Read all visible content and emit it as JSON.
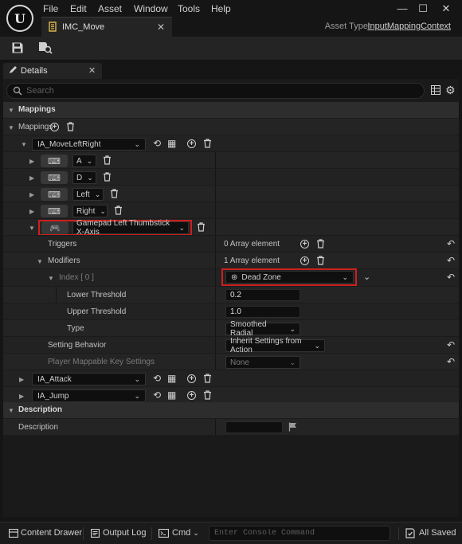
{
  "menu": [
    "File",
    "Edit",
    "Asset",
    "Window",
    "Tools",
    "Help"
  ],
  "asset_tab": {
    "title": "IMC_Move",
    "asset_type_label": "Asset Type:",
    "asset_type_value": "InputMappingContext"
  },
  "details_tab": {
    "label": "Details"
  },
  "search": {
    "placeholder": "Search"
  },
  "sections": {
    "mappings": "Mappings",
    "description": "Description"
  },
  "mappings": {
    "label": "Mappings",
    "actions": [
      {
        "name": "IA_MoveLeftRight",
        "keys": [
          "A",
          "D",
          "Left",
          "Right",
          "Gamepad Left Thumbstick X-Axis"
        ]
      },
      {
        "name": "IA_Attack"
      },
      {
        "name": "IA_Jump"
      }
    ],
    "triggers": {
      "label": "Triggers",
      "value": "0 Array element"
    },
    "modifiers": {
      "label": "Modifiers",
      "value": "1 Array element"
    },
    "index": {
      "label": "Index [ 0 ]",
      "value": "Dead Zone"
    },
    "lower_threshold": {
      "label": "Lower Threshold",
      "value": "0.2"
    },
    "upper_threshold": {
      "label": "Upper Threshold",
      "value": "1.0"
    },
    "type": {
      "label": "Type",
      "value": "Smoothed Radial"
    },
    "setting_behavior": {
      "label": "Setting Behavior",
      "value": "Inherit Settings from Action"
    },
    "player_mappable": {
      "label": "Player Mappable Key Settings",
      "value": "None"
    }
  },
  "description": {
    "label": "Description",
    "value": ""
  },
  "statusbar": {
    "content_drawer": "Content Drawer",
    "output_log": "Output Log",
    "cmd": "Cmd",
    "console_placeholder": "Enter Console Command",
    "all_saved": "All Saved"
  },
  "colors": {
    "highlight": "#cc1f1f",
    "panel": "#242424",
    "background": "#151515",
    "accent_gold": "#d8b64b"
  }
}
